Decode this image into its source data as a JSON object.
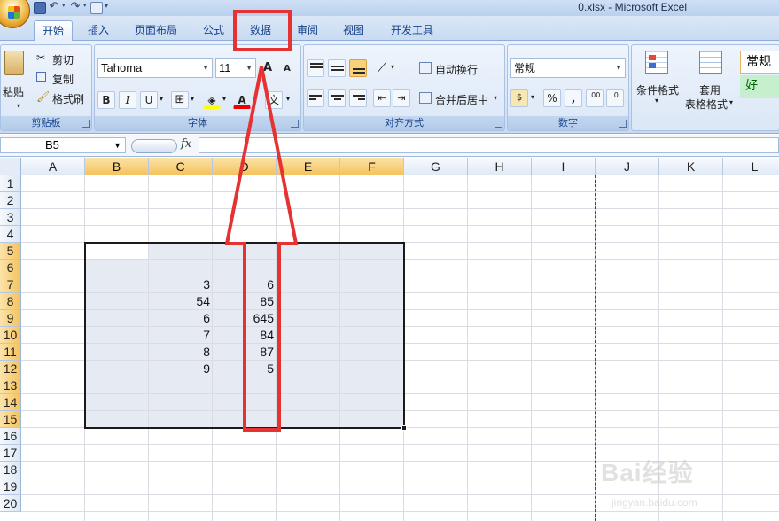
{
  "window": {
    "title": "0.xlsx - Microsoft Excel"
  },
  "tabs": [
    {
      "id": "home",
      "label": "开始",
      "active": true
    },
    {
      "id": "insert",
      "label": "插入"
    },
    {
      "id": "page_layout",
      "label": "页面布局"
    },
    {
      "id": "formulas",
      "label": "公式"
    },
    {
      "id": "data",
      "label": "数据",
      "highlighted": true
    },
    {
      "id": "review",
      "label": "审阅"
    },
    {
      "id": "view",
      "label": "视图"
    },
    {
      "id": "developer",
      "label": "开发工具"
    }
  ],
  "ribbon": {
    "clipboard": {
      "label": "剪贴板",
      "paste": "粘贴",
      "cut": "剪切",
      "copy": "复制",
      "format_painter": "格式刷"
    },
    "font": {
      "label": "字体",
      "name": "Tahoma",
      "size": "11",
      "bold": "B",
      "italic": "I",
      "underline": "U",
      "font_color_glyph": "A",
      "grow": "A",
      "shrink": "A",
      "phonetic": "文"
    },
    "alignment": {
      "label": "对齐方式",
      "wrap_text": "自动换行",
      "merge_center": "合并后居中"
    },
    "number": {
      "label": "数字",
      "format": "常规",
      "percent": "%",
      "comma": ",",
      "inc_decimal": ".00",
      "dec_decimal": ".0"
    },
    "styles": {
      "conditional_format": "条件格式",
      "table_format": "套用",
      "table_format_2": "表格格式",
      "normal": "常规",
      "good": "好"
    }
  },
  "formula_bar": {
    "name_box": "B5",
    "fx": "fx",
    "value": ""
  },
  "columns": [
    "A",
    "B",
    "C",
    "D",
    "E",
    "F",
    "G",
    "H",
    "I",
    "J",
    "K",
    "L"
  ],
  "selected_columns": [
    "B",
    "C",
    "D",
    "E",
    "F"
  ],
  "rows": [
    "1",
    "2",
    "3",
    "4",
    "5",
    "6",
    "7",
    "8",
    "9",
    "10",
    "11",
    "12",
    "13",
    "14",
    "15",
    "16",
    "17",
    "18",
    "19",
    "20"
  ],
  "selected_rows": [
    "5",
    "6",
    "7",
    "8",
    "9",
    "10",
    "11",
    "12",
    "13",
    "14",
    "15"
  ],
  "cells": {
    "C7": "3",
    "D7": "6",
    "C8": "54",
    "D8": "85",
    "C9": "6",
    "D9": "645",
    "C10": "7",
    "D10": "84",
    "C11": "8",
    "D11": "87",
    "C12": "9",
    "D12": "5"
  },
  "selection_range": "B5:F15",
  "annotation": {
    "color": "#e53333",
    "points_to": "数据"
  },
  "watermark": {
    "text": "Bai经验",
    "url": "jingyan.baidu.com"
  },
  "colors": {
    "ribbon": "#dbe7f6",
    "selected_header": "#f5c35e",
    "selection_fill": "#e6eaf3"
  }
}
